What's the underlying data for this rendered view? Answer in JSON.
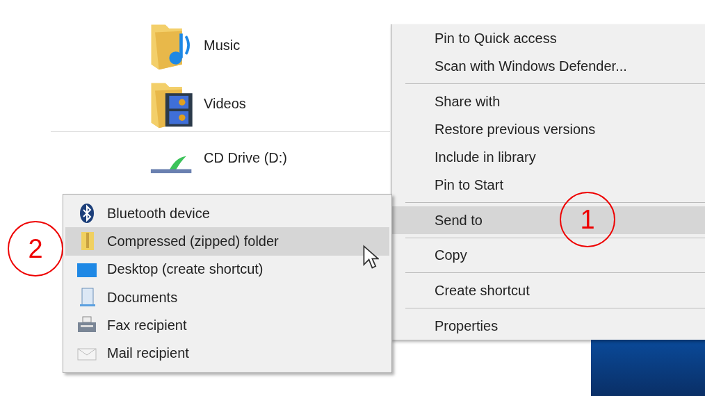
{
  "explorer": {
    "folders": [
      {
        "label": "Music",
        "kind": "music"
      },
      {
        "label": "Videos",
        "kind": "videos"
      }
    ],
    "drives": [
      {
        "label": "CD Drive (D:)",
        "kind": "cd"
      }
    ]
  },
  "context_menu": {
    "groups": [
      [
        {
          "label": "Pin to Quick access",
          "selected": false
        },
        {
          "label": "Scan with Windows Defender...",
          "selected": false
        }
      ],
      [
        {
          "label": "Share with",
          "selected": false
        },
        {
          "label": "Restore previous versions",
          "selected": false
        },
        {
          "label": "Include in library",
          "selected": false
        },
        {
          "label": "Pin to Start",
          "selected": false
        }
      ],
      [
        {
          "label": "Send to",
          "selected": true
        }
      ],
      [
        {
          "label": "Copy",
          "selected": false
        }
      ],
      [
        {
          "label": "Create shortcut",
          "selected": false
        }
      ],
      [
        {
          "label": "Properties",
          "selected": false
        }
      ]
    ]
  },
  "submenu": {
    "items": [
      {
        "label": "Bluetooth device",
        "kind": "bluetooth",
        "selected": false
      },
      {
        "label": "Compressed (zipped) folder",
        "kind": "zip",
        "selected": true
      },
      {
        "label": "Desktop (create shortcut)",
        "kind": "desktop",
        "selected": false
      },
      {
        "label": "Documents",
        "kind": "documents",
        "selected": false
      },
      {
        "label": "Fax recipient",
        "kind": "fax",
        "selected": false
      },
      {
        "label": "Mail recipient",
        "kind": "mail",
        "selected": false
      }
    ]
  },
  "annotations": [
    {
      "label": "1"
    },
    {
      "label": "2"
    }
  ]
}
